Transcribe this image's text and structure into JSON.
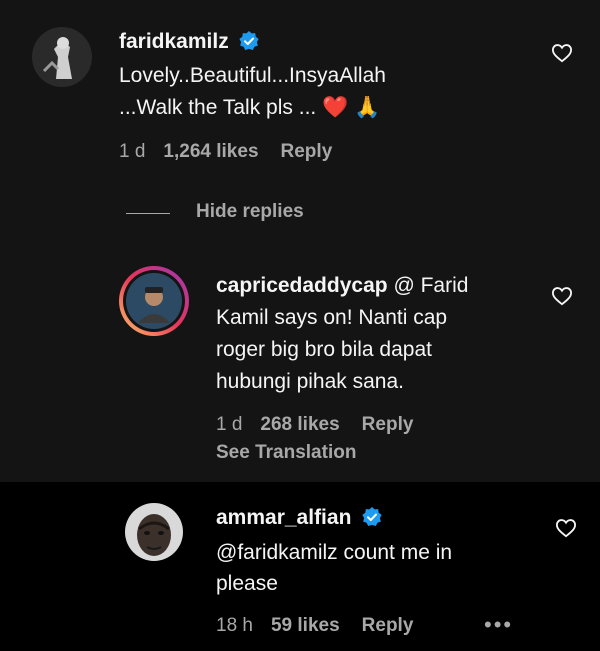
{
  "comments": [
    {
      "username": "faridkamilz",
      "verified": true,
      "text_line1": "Lovely..Beautiful...InsyaAllah",
      "text_line2": "...Walk the Talk pls ... ❤️ 🙏",
      "time": "1 d",
      "likes": "1,264 likes",
      "reply_label": "Reply",
      "like_icon": "heart-outline-icon"
    }
  ],
  "hide_replies_label": "Hide replies",
  "replies": [
    {
      "username": "capricedaddycap",
      "mention": "@ Farid",
      "text_lines": [
        "Kamil says on! Nanti cap",
        "roger big bro bila dapat",
        "hubungi pihak sana."
      ],
      "time": "1 d",
      "likes": "268 likes",
      "reply_label": "Reply",
      "see_translation": "See Translation"
    },
    {
      "username": "ammar_alfian",
      "verified": true,
      "text_line1": "@faridkamilz count me in",
      "text_line2": "please",
      "time": "18 h",
      "likes": "59 likes",
      "reply_label": "Reply",
      "more_label": "•••"
    }
  ],
  "colors": {
    "background_top": "#141414",
    "background_bottom": "#000000",
    "verified_blue": "#1d9bf0",
    "muted_text": "#a8a8a8"
  }
}
